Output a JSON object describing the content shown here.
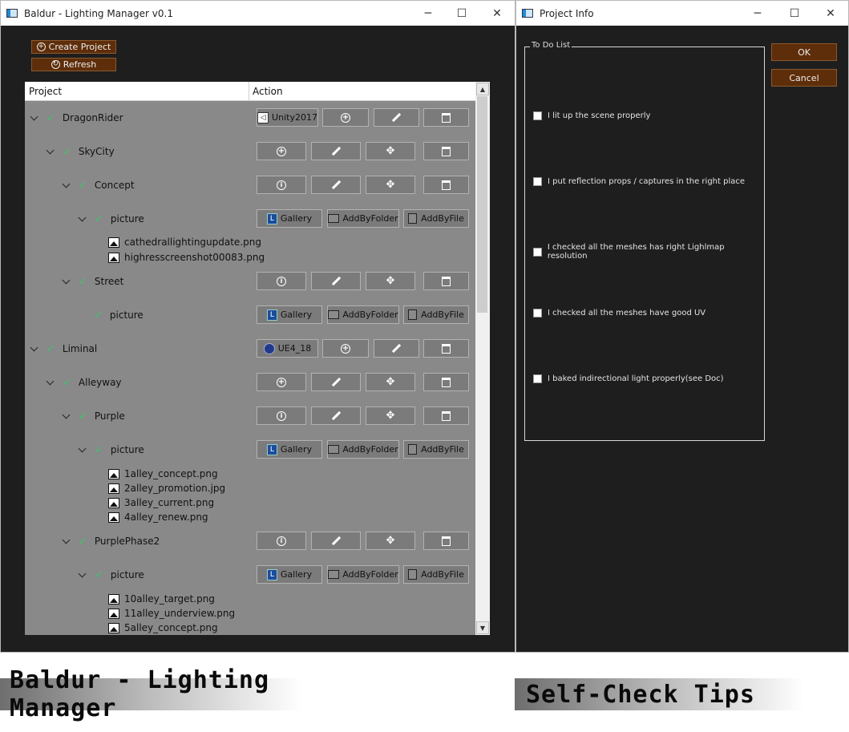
{
  "main_window": {
    "title": "Baldur - Lighting Manager v0.1",
    "titlebar_buttons": {
      "minimize": "─",
      "maximize": "☐",
      "close": "✕"
    },
    "create_project_label": "Create Project",
    "refresh_label": "Refresh",
    "tree": {
      "col_project": "Project",
      "col_action": "Action",
      "rows": [
        {
          "label": "DragonRider",
          "kind": "project"
        },
        {
          "label": "SkyCity",
          "kind": "scene"
        },
        {
          "label": "Concept",
          "kind": "shot"
        },
        {
          "label": "picture",
          "kind": "picture"
        },
        {
          "label": "cathedrallightingupdate.png",
          "kind": "file"
        },
        {
          "label": "highresscreenshot00083.png",
          "kind": "file"
        },
        {
          "label": "Street",
          "kind": "shot"
        },
        {
          "label": "picture",
          "kind": "picture"
        },
        {
          "label": "Liminal",
          "kind": "project"
        },
        {
          "label": "Alleyway",
          "kind": "scene"
        },
        {
          "label": "Purple",
          "kind": "shot"
        },
        {
          "label": "picture",
          "kind": "picture"
        },
        {
          "label": "1alley_concept.png",
          "kind": "file"
        },
        {
          "label": "2alley_promotion.jpg",
          "kind": "file"
        },
        {
          "label": "3alley_current.png",
          "kind": "file"
        },
        {
          "label": "4alley_renew.png",
          "kind": "file"
        },
        {
          "label": "PurplePhase2",
          "kind": "shot"
        },
        {
          "label": "picture",
          "kind": "picture"
        },
        {
          "label": "10alley_target.png",
          "kind": "file"
        },
        {
          "label": "11alley_underview.png",
          "kind": "file"
        },
        {
          "label": "5alley_concept.png",
          "kind": "file"
        }
      ],
      "engines": {
        "dragonrider": "Unity2017",
        "liminal": "UE4_18"
      },
      "gallery_label": "Gallery",
      "add_by_folder_label": "AddByFolder",
      "add_by_file_label": "AddByFile"
    }
  },
  "info_window": {
    "title": "Project Info",
    "todo_legend": "To Do List",
    "todo_items": [
      "I lit up the scene properly",
      "I put reflection props / captures in the right place",
      "I checked all the meshes has right Lighlmap resolution",
      "I checked all the meshes have good UV",
      "I baked indirectional light properly(see Doc)"
    ],
    "ok_label": "OK",
    "cancel_label": "Cancel"
  },
  "banners": {
    "left": "Baldur - Lighting Manager",
    "right": "Self-Check Tips"
  },
  "colors": {
    "accent_brown": "#5e2d09",
    "check_green": "#3ec46d",
    "window_bg": "#1e1e1e",
    "tree_bg": "#898989"
  }
}
